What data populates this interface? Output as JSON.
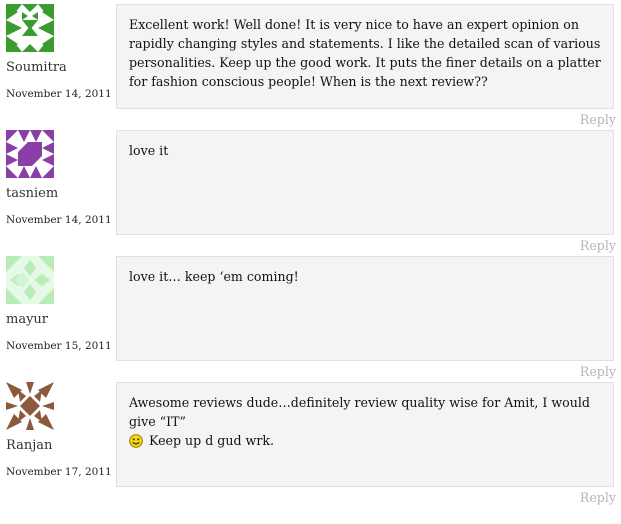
{
  "comments": [
    {
      "author": "Soumitra",
      "date": "November 14, 2011",
      "avatar_icon": "green-geometric-identicon",
      "avatar_color": "#3a9c2e",
      "text": "Excellent work! Well done! It is very nice to have an expert opinion on rapidly changing styles and statements. I like the detailed scan of various personalities. Keep up the good work. It puts the finer details on a platter for fashion conscious people! When is the next review??",
      "reply_label": "Reply"
    },
    {
      "author": "tasniem",
      "date": "November 14, 2011",
      "avatar_icon": "purple-geometric-identicon",
      "avatar_color": "#8a3fa8",
      "text": "love it",
      "reply_label": "Reply"
    },
    {
      "author": "mayur",
      "date": "November 15, 2011",
      "avatar_icon": "pale-green-geometric-identicon",
      "avatar_color": "#c8f0c8",
      "text": "love it… keep ‘em coming!",
      "reply_label": "Reply"
    },
    {
      "author": "Ranjan",
      "date": "November 17, 2011",
      "avatar_icon": "brown-geometric-identicon",
      "avatar_color": "#8b5a3c",
      "text_before_emoji": "Awesome reviews dude…definitely review quality wise for Amit, I would give “IT”",
      "emoji_icon": "smiley-face-icon",
      "text_after_emoji": "Keep up d gud wrk.",
      "reply_label": "Reply"
    }
  ]
}
